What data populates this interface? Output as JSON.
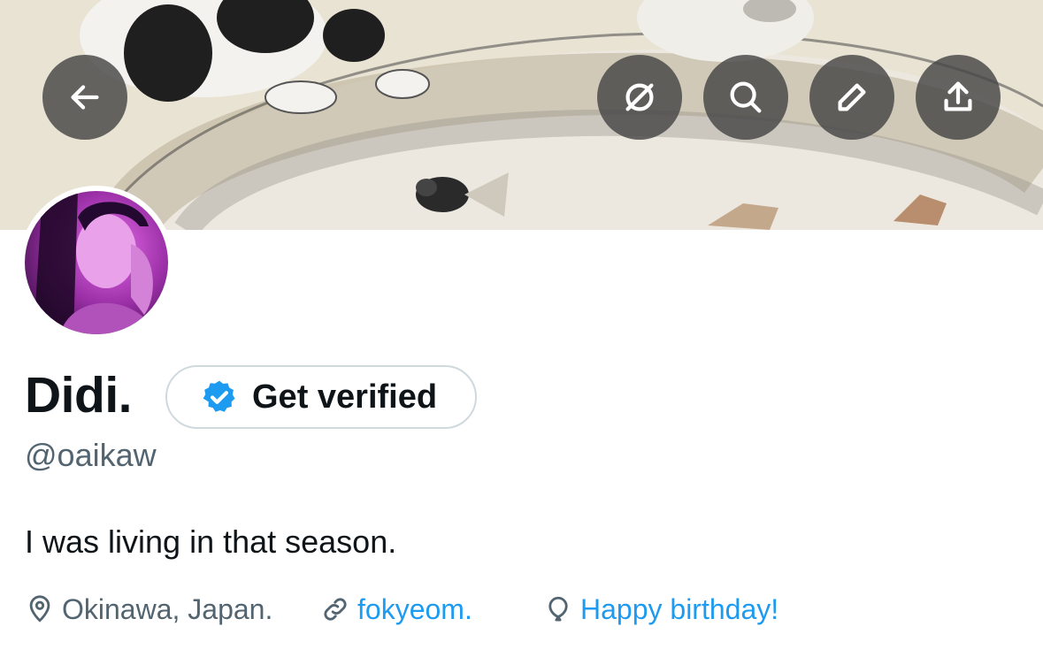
{
  "colors": {
    "accent": "#1d9bf0",
    "text_primary": "#0f1419",
    "text_secondary": "#536471",
    "verified_badge": "#1d9bf0",
    "header_button_bg": "#464646"
  },
  "header": {
    "back_icon": "arrow-left-icon",
    "actions": [
      {
        "icon": "grok-icon"
      },
      {
        "icon": "search-icon"
      },
      {
        "icon": "edit-icon"
      },
      {
        "icon": "share-icon"
      }
    ]
  },
  "profile": {
    "display_name": "Didi.",
    "verify_button_label": "Get verified",
    "verify_icon": "verified-badge-icon",
    "handle": "@oaikaw",
    "bio": "I was living in that season.",
    "location": "Okinawa, Japan.",
    "website": "fokyeom.",
    "birthday": "Happy birthday!"
  }
}
